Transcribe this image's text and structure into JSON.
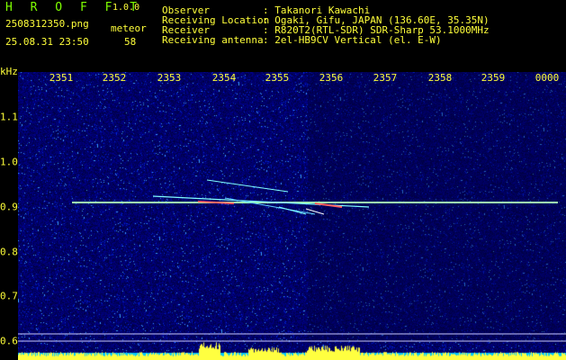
{
  "header": {
    "app_name": "H R O F F T",
    "version": "1.0.0",
    "filename": "2508312350.png",
    "timestamp": "25.08.31 23:50",
    "meteor_label": "meteor",
    "meteor_count": "58"
  },
  "info": {
    "observer_label": "Observer",
    "observer_value": ": Takanori Kawachi",
    "location_label": "Receiving Location",
    "location_value": ": Ogaki, Gifu, JAPAN (136.60E, 35.35N)",
    "receiver_label": "Receiver",
    "receiver_value": ": R820T2(RTL-SDR) SDR-Sharp 53.1000MHz",
    "antenna_label": "Receiving antenna",
    "antenna_value": ": 2el-HB9CV Vertical (el. E-W)"
  },
  "plot": {
    "y_unit": "kHz",
    "x_ticks": [
      "2351",
      "2352",
      "2353",
      "2354",
      "2355",
      "2356",
      "2357",
      "2358",
      "2359",
      "0000"
    ],
    "y_ticks": [
      "1.1",
      "1.0",
      "0.9",
      "0.8",
      "0.7",
      "0.6"
    ],
    "colors": {
      "background": "#00006a",
      "carrier": "#9fffb0",
      "text": "#ffff3a"
    }
  }
}
